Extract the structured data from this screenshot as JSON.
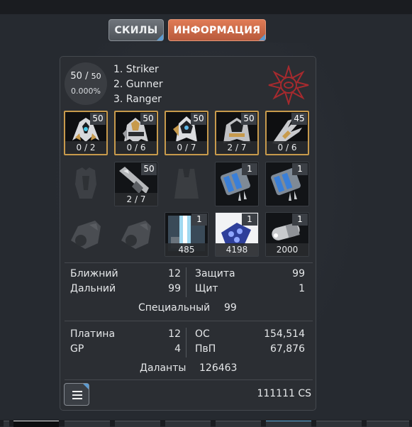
{
  "tabs": {
    "skills_label": "СКИЛЫ",
    "info_label": "ИНФОРМАЦИЯ",
    "active": "info",
    "active_color": "#d06a46"
  },
  "profile": {
    "level_current": "50",
    "level_max": "50",
    "xp_percent": "0.000%",
    "classes": [
      "1. Striker",
      "2. Gunner",
      "3. Ranger"
    ],
    "emblem_icon": "spiked-sun-emblem-icon"
  },
  "equipment": {
    "row1": [
      {
        "icon": "striker-armor-icon",
        "level": "50",
        "count": "0 / 2"
      },
      {
        "icon": "gunner-armor-icon",
        "level": "50",
        "count": "0 / 6"
      },
      {
        "icon": "ranger-armor-icon",
        "level": "50",
        "count": "0 / 7"
      },
      {
        "icon": "heavy-armor-icon",
        "level": "50",
        "count": "2 / 7"
      },
      {
        "icon": "weapon-claw-icon",
        "level": "45",
        "count": "0 / 6"
      }
    ],
    "row2": [
      {
        "icon": "empty-torso-slot-icon"
      },
      {
        "icon": "launcher-weapon-icon",
        "level": "50",
        "count": "2 / 7"
      },
      {
        "icon": "empty-cloak-slot-icon"
      },
      {
        "icon": "blue-battery-icon",
        "level": "1"
      },
      {
        "icon": "blue-battery-icon",
        "level": "1"
      }
    ],
    "row3": [
      {
        "icon": "empty-drone-slot-icon"
      },
      {
        "icon": "empty-drone-slot-icon"
      },
      {
        "icon": "energy-beam-item-icon",
        "level": "1",
        "count": "485"
      },
      {
        "icon": "blue-crystal-ammo-icon",
        "level": "1",
        "count": "4198"
      },
      {
        "icon": "silver-capsule-icon",
        "level": "1",
        "count": "2000"
      }
    ]
  },
  "stats": {
    "melee_label": "Ближний",
    "melee_value": "12",
    "ranged_label": "Дальний",
    "ranged_value": "99",
    "defense_label": "Защита",
    "defense_value": "99",
    "shield_label": "Щит",
    "shield_value": "1",
    "special_label": "Специальный",
    "special_value": "99"
  },
  "currency": {
    "platinum_label": "Платина",
    "platinum_value": "12",
    "gp_label": "GP",
    "gp_value": "4",
    "os_label": "ОС",
    "os_value": "154,514",
    "pvp_label": "ПвП",
    "pvp_value": "67,876",
    "talents_label": "Даланты",
    "talents_value": "126463"
  },
  "footer": {
    "menu_icon": "hamburger-menu-icon",
    "cs_text": "111111 CS"
  }
}
